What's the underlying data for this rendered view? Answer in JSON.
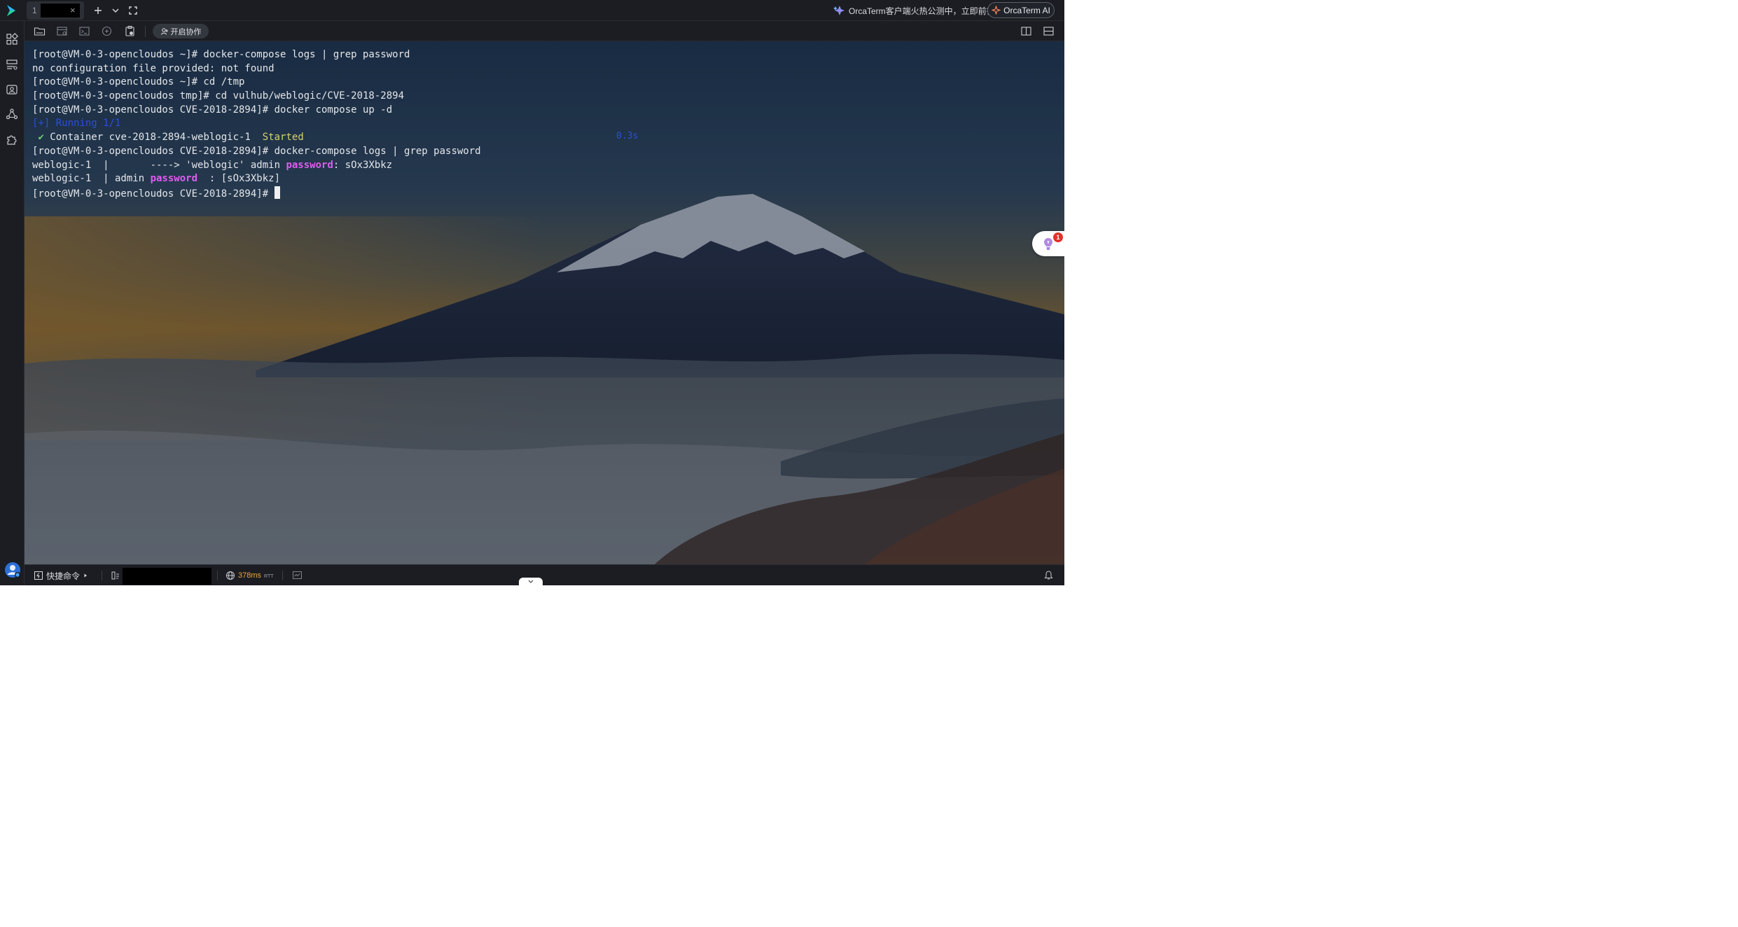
{
  "window": {
    "tab": {
      "index": "1",
      "title": "",
      "close_glyph": "×"
    },
    "promo_text": "OrcaTerm客户端火热公测中，立即前往",
    "ai_button_label": "OrcaTerm AI"
  },
  "toolbar": {
    "collab_label": "开启协作"
  },
  "terminal": {
    "lines": [
      [
        {
          "t": "[root@VM-0-3-opencloudos ~]# docker-compose logs | grep password"
        }
      ],
      [
        {
          "t": "no configuration file provided: not found"
        }
      ],
      [
        {
          "t": "[root@VM-0-3-opencloudos ~]# cd /tmp"
        }
      ],
      [
        {
          "t": "[root@VM-0-3-opencloudos tmp]# cd vulhub/weblogic/CVE-2018-2894"
        }
      ],
      [
        {
          "t": "[root@VM-0-3-opencloudos CVE-2018-2894]# docker compose up -d"
        }
      ],
      [
        {
          "t": "[+] Running 1/1",
          "c": "blue"
        }
      ],
      [
        {
          "t": " "
        },
        {
          "t": "✔",
          "c": "green"
        },
        {
          "t": " Container cve-2018-2894-weblogic-1  "
        },
        {
          "t": "Started",
          "c": "yellow"
        }
      ],
      [
        {
          "t": "[root@VM-0-3-opencloudos CVE-2018-2894]# docker-compose logs | grep password"
        }
      ],
      [
        {
          "t": "weblogic-1  |       ----> 'weblogic' admin "
        },
        {
          "t": "password",
          "c": "mag"
        },
        {
          "t": ": sOx3Xbkz"
        }
      ],
      [
        {
          "t": "weblogic-1  | admin "
        },
        {
          "t": "password",
          "c": "mag"
        },
        {
          "t": "  : [sOx3Xbkz]"
        }
      ],
      [
        {
          "t": "[root@VM-0-3-opencloudos CVE-2018-2894]# "
        },
        {
          "cursor": true
        }
      ]
    ],
    "timing": "0.3s"
  },
  "notification_badge": "1",
  "statusbar": {
    "quick_commands_label": "快捷命令",
    "host": "",
    "latency_value": "378ms",
    "latency_unit": "RTT"
  },
  "colors": {
    "accent_blue": "#2b4fd8",
    "password_highlight": "#e05cf0",
    "latency": "#f0a53a"
  }
}
